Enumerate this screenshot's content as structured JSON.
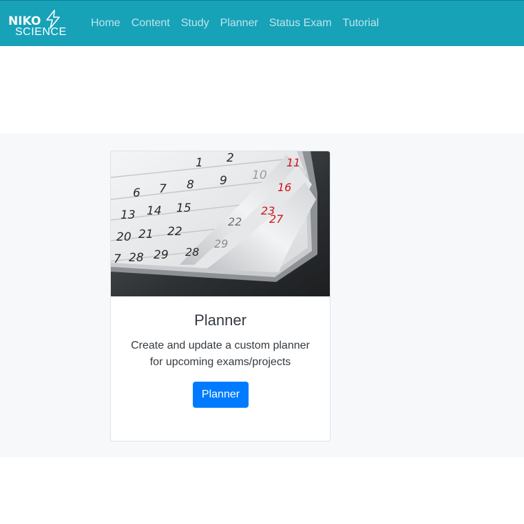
{
  "navbar": {
    "brand_line1": "NIKO",
    "brand_line2": "SCIENCE",
    "brand_icon": "lightning-bolt-icon",
    "links": [
      "Home",
      "Content",
      "Study",
      "Planner",
      "Status Exam",
      "Tutorial"
    ]
  },
  "card": {
    "image": "calendar-pages-photo",
    "title": "Planner",
    "text": "Create and update a custom planner for upcoming exams/projects",
    "button_label": "Planner"
  },
  "colors": {
    "navbar": "#17a2b8",
    "button": "#007bff",
    "band": "#f7f8fa"
  }
}
